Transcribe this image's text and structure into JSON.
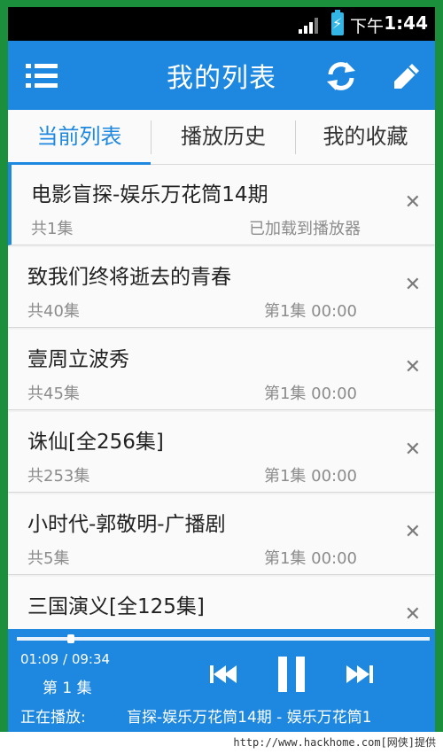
{
  "status_bar": {
    "period": "下午",
    "time": "1:44",
    "battery_icon": "battery-charging-icon",
    "signal_icon": "signal-icon"
  },
  "header": {
    "title": "我的列表",
    "menu_icon": "menu-icon",
    "refresh_icon": "refresh-icon",
    "edit_icon": "edit-icon",
    "color": "#1e88e0"
  },
  "tabs": [
    {
      "label": "当前列表",
      "active": true
    },
    {
      "label": "播放历史",
      "active": false
    },
    {
      "label": "我的收藏",
      "active": false
    }
  ],
  "playlist": [
    {
      "title": "电影盲探-娱乐万花筒14期",
      "episodes": "共1集",
      "status": "已加载到播放器",
      "current": true
    },
    {
      "title": "致我们终将逝去的青春",
      "episodes": "共40集",
      "status": "第1集 00:00",
      "current": false
    },
    {
      "title": "壹周立波秀",
      "episodes": "共45集",
      "status": "第1集 00:00",
      "current": false
    },
    {
      "title": "诛仙[全256集]",
      "episodes": "共253集",
      "status": "第1集 00:00",
      "current": false
    },
    {
      "title": "小时代-郭敬明-广播剧",
      "episodes": "共5集",
      "status": "第1集 00:00",
      "current": false
    },
    {
      "title": "三国演义[全125集]",
      "episodes": "",
      "status": "",
      "current": false
    }
  ],
  "player": {
    "time": "01:09 / 09:34",
    "progress_fraction": 0.122,
    "episode": "第 1 集",
    "now_playing_label": "正在播放:",
    "now_playing_title": "盲探-娱乐万花筒14期 - 娱乐万花筒1"
  },
  "watermark": "http://www.hackhome.com[网侠]提供"
}
